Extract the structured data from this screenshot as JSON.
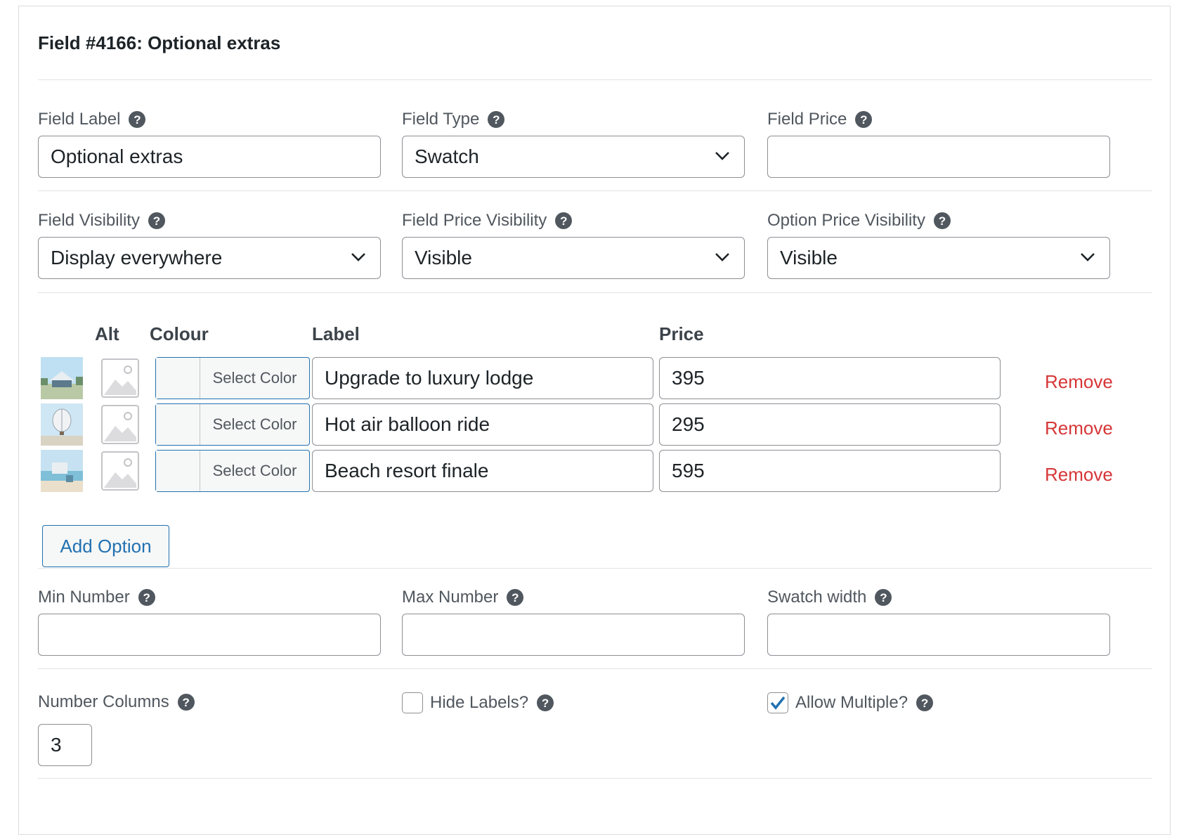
{
  "title": "Field #4166: Optional extras",
  "row1": {
    "field_label": {
      "label": "Field Label",
      "value": "Optional extras"
    },
    "field_type": {
      "label": "Field Type",
      "value": "Swatch"
    },
    "field_price": {
      "label": "Field Price",
      "value": ""
    }
  },
  "row2": {
    "field_visibility": {
      "label": "Field Visibility",
      "value": "Display everywhere"
    },
    "field_price_visibility": {
      "label": "Field Price Visibility",
      "value": "Visible"
    },
    "option_price_visibility": {
      "label": "Option Price Visibility",
      "value": "Visible"
    }
  },
  "options": {
    "headers": {
      "alt": "Alt",
      "colour": "Colour",
      "label": "Label",
      "price": "Price"
    },
    "select_color_label": "Select Color",
    "remove_label": "Remove",
    "rows": [
      {
        "label": "Upgrade to luxury lodge",
        "price": "395",
        "thumb": "lodge-image"
      },
      {
        "label": "Hot air balloon ride",
        "price": "295",
        "thumb": "balloon-image"
      },
      {
        "label": "Beach resort finale",
        "price": "595",
        "thumb": "beach-image"
      }
    ],
    "add_option_label": "Add Option"
  },
  "row3": {
    "min_number": {
      "label": "Min Number",
      "value": ""
    },
    "max_number": {
      "label": "Max Number",
      "value": ""
    },
    "swatch_width": {
      "label": "Swatch width",
      "value": ""
    }
  },
  "row4": {
    "number_columns": {
      "label": "Number Columns",
      "value": "3"
    },
    "hide_labels": {
      "label": "Hide Labels?",
      "checked": false
    },
    "allow_multiple": {
      "label": "Allow Multiple?",
      "checked": true
    }
  },
  "colors": {
    "accent": "#2271b1",
    "remove": "#d63638",
    "help": "#50575e"
  }
}
